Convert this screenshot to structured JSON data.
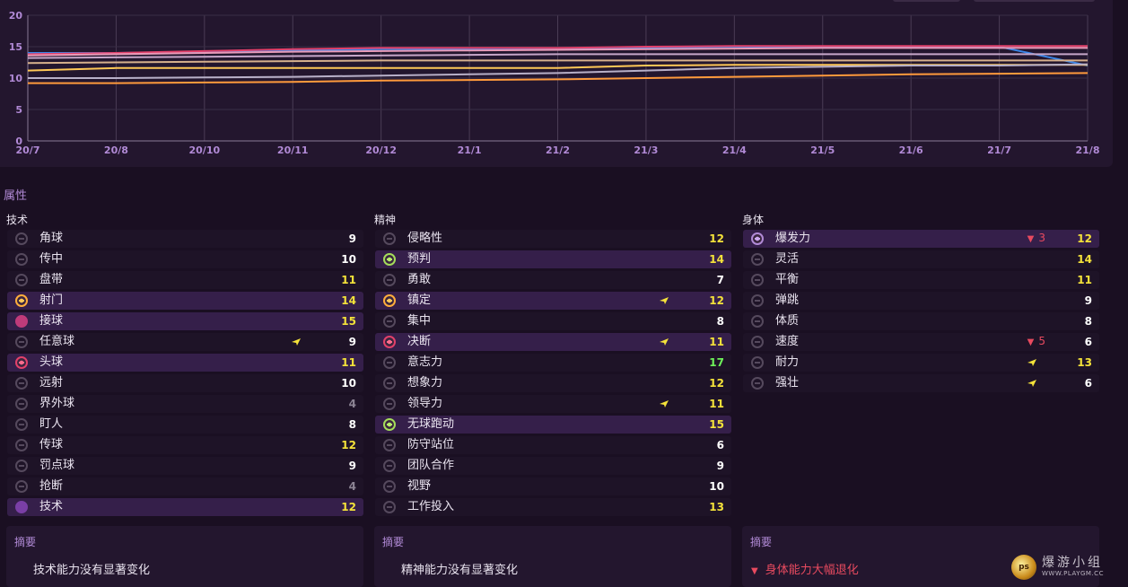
{
  "chart_data": {
    "type": "line",
    "categories": [
      "20/7",
      "20/8",
      "20/10",
      "20/11",
      "20/12",
      "21/1",
      "21/2",
      "21/3",
      "21/4",
      "21/5",
      "21/6",
      "21/7",
      "21/8"
    ],
    "ylim": [
      0,
      20
    ],
    "yticks": [
      "0",
      "5",
      "10",
      "15",
      "20"
    ],
    "grid": true,
    "series": [
      {
        "color": "#3a86e8",
        "values": [
          14,
          14,
          14.2,
          14.4,
          14.6,
          14.6,
          14.6,
          14.8,
          15,
          15,
          15,
          15,
          12
        ]
      },
      {
        "color": "#e2406a",
        "values": [
          13.8,
          14,
          14.3,
          14.6,
          14.8,
          14.8,
          14.8,
          15,
          15.1,
          15.1,
          15.1,
          15.1,
          15.1
        ]
      },
      {
        "color": "#e89ab8",
        "values": [
          13.6,
          13.8,
          14,
          14.2,
          14.3,
          14.4,
          14.5,
          14.6,
          14.7,
          14.8,
          14.8,
          14.8,
          14.8
        ]
      },
      {
        "color": "#c7a7c9",
        "values": [
          13.2,
          13.3,
          13.4,
          13.5,
          13.6,
          13.7,
          13.8,
          13.8,
          13.8,
          13.8,
          13.8,
          13.8,
          13.8
        ]
      },
      {
        "color": "#d6b08c",
        "values": [
          12.4,
          12.5,
          12.6,
          12.7,
          12.8,
          12.8,
          12.8,
          12.8,
          12.8,
          12.8,
          12.8,
          12.8,
          12.8
        ]
      },
      {
        "color": "#ffc857",
        "values": [
          11.2,
          11.6,
          11.6,
          11.6,
          11.6,
          11.6,
          11.6,
          12,
          12.1,
          12.1,
          12.1,
          12.1,
          12.1
        ]
      },
      {
        "color": "#b8b0c8",
        "values": [
          10,
          10,
          10.1,
          10.2,
          10.4,
          10.6,
          10.8,
          11.2,
          11.6,
          11.8,
          12,
          12,
          12.2
        ]
      },
      {
        "color": "#ff9a3c",
        "values": [
          9.2,
          9.2,
          9.3,
          9.4,
          9.6,
          9.7,
          9.8,
          10,
          10.2,
          10.4,
          10.6,
          10.7,
          10.8
        ]
      }
    ]
  },
  "section_title": "属性",
  "columns": [
    {
      "title": "技术",
      "rows": [
        {
          "name": "角球",
          "value": "9",
          "vc": "w",
          "dot": "",
          "hl": false,
          "trend": false,
          "drop": ""
        },
        {
          "name": "传中",
          "value": "10",
          "vc": "w",
          "dot": "",
          "hl": false,
          "trend": false,
          "drop": ""
        },
        {
          "name": "盘带",
          "value": "11",
          "vc": "y",
          "dot": "",
          "hl": false,
          "trend": false,
          "drop": ""
        },
        {
          "name": "射门",
          "value": "14",
          "vc": "y",
          "dot": "c-y",
          "hl": true,
          "trend": false,
          "drop": ""
        },
        {
          "name": "接球",
          "value": "15",
          "vc": "y",
          "dot": "c-m",
          "hl": true,
          "trend": false,
          "drop": ""
        },
        {
          "name": "任意球",
          "value": "9",
          "vc": "w",
          "dot": "",
          "hl": false,
          "trend": true,
          "drop": ""
        },
        {
          "name": "头球",
          "value": "11",
          "vc": "y",
          "dot": "c-r",
          "hl": true,
          "trend": false,
          "drop": ""
        },
        {
          "name": "远射",
          "value": "10",
          "vc": "w",
          "dot": "",
          "hl": false,
          "trend": false,
          "drop": ""
        },
        {
          "name": "界外球",
          "value": "4",
          "vc": "dim",
          "dot": "",
          "hl": false,
          "trend": false,
          "drop": ""
        },
        {
          "name": "盯人",
          "value": "8",
          "vc": "w",
          "dot": "",
          "hl": false,
          "trend": false,
          "drop": ""
        },
        {
          "name": "传球",
          "value": "12",
          "vc": "y",
          "dot": "",
          "hl": false,
          "trend": false,
          "drop": ""
        },
        {
          "name": "罚点球",
          "value": "9",
          "vc": "w",
          "dot": "",
          "hl": false,
          "trend": false,
          "drop": ""
        },
        {
          "name": "抢断",
          "value": "4",
          "vc": "dim",
          "dot": "",
          "hl": false,
          "trend": false,
          "drop": ""
        },
        {
          "name": "技术",
          "value": "12",
          "vc": "y",
          "dot": "c-full",
          "hl": true,
          "trend": false,
          "drop": ""
        }
      ]
    },
    {
      "title": "精神",
      "rows": [
        {
          "name": "侵略性",
          "value": "12",
          "vc": "y",
          "dot": "",
          "hl": false,
          "trend": false,
          "drop": ""
        },
        {
          "name": "预判",
          "value": "14",
          "vc": "y",
          "dot": "c-g",
          "hl": true,
          "trend": false,
          "drop": ""
        },
        {
          "name": "勇敢",
          "value": "7",
          "vc": "w",
          "dot": "",
          "hl": false,
          "trend": false,
          "drop": ""
        },
        {
          "name": "镇定",
          "value": "12",
          "vc": "y",
          "dot": "c-y",
          "hl": true,
          "trend": true,
          "drop": ""
        },
        {
          "name": "集中",
          "value": "8",
          "vc": "w",
          "dot": "",
          "hl": false,
          "trend": false,
          "drop": ""
        },
        {
          "name": "决断",
          "value": "11",
          "vc": "y",
          "dot": "c-r",
          "hl": true,
          "trend": true,
          "drop": ""
        },
        {
          "name": "意志力",
          "value": "17",
          "vc": "gr",
          "dot": "",
          "hl": false,
          "trend": false,
          "drop": ""
        },
        {
          "name": "想象力",
          "value": "12",
          "vc": "y",
          "dot": "",
          "hl": false,
          "trend": false,
          "drop": ""
        },
        {
          "name": "领导力",
          "value": "11",
          "vc": "y",
          "dot": "",
          "hl": false,
          "trend": true,
          "drop": ""
        },
        {
          "name": "无球跑动",
          "value": "15",
          "vc": "y",
          "dot": "c-g",
          "hl": true,
          "trend": false,
          "drop": ""
        },
        {
          "name": "防守站位",
          "value": "6",
          "vc": "w",
          "dot": "",
          "hl": false,
          "trend": false,
          "drop": ""
        },
        {
          "name": "团队合作",
          "value": "9",
          "vc": "w",
          "dot": "",
          "hl": false,
          "trend": false,
          "drop": ""
        },
        {
          "name": "视野",
          "value": "10",
          "vc": "w",
          "dot": "",
          "hl": false,
          "trend": false,
          "drop": ""
        },
        {
          "name": "工作投入",
          "value": "13",
          "vc": "y",
          "dot": "",
          "hl": false,
          "trend": false,
          "drop": ""
        }
      ]
    },
    {
      "title": "身体",
      "rows": [
        {
          "name": "爆发力",
          "value": "12",
          "vc": "y",
          "dot": "c-p",
          "hl": true,
          "trend": false,
          "drop": "3"
        },
        {
          "name": "灵活",
          "value": "14",
          "vc": "y",
          "dot": "",
          "hl": false,
          "trend": false,
          "drop": ""
        },
        {
          "name": "平衡",
          "value": "11",
          "vc": "y",
          "dot": "",
          "hl": false,
          "trend": false,
          "drop": ""
        },
        {
          "name": "弹跳",
          "value": "9",
          "vc": "w",
          "dot": "",
          "hl": false,
          "trend": false,
          "drop": ""
        },
        {
          "name": "体质",
          "value": "8",
          "vc": "w",
          "dot": "",
          "hl": false,
          "trend": false,
          "drop": ""
        },
        {
          "name": "速度",
          "value": "6",
          "vc": "w",
          "dot": "",
          "hl": false,
          "trend": false,
          "drop": "5"
        },
        {
          "name": "耐力",
          "value": "13",
          "vc": "y",
          "dot": "",
          "hl": false,
          "trend": true,
          "drop": ""
        },
        {
          "name": "强壮",
          "value": "6",
          "vc": "w",
          "dot": "",
          "hl": false,
          "trend": true,
          "drop": ""
        }
      ]
    }
  ],
  "summaries": [
    {
      "title": "摘要",
      "text": "技术能力没有显著变化",
      "negative": false
    },
    {
      "title": "摘要",
      "text": "精神能力没有显著变化",
      "negative": false
    },
    {
      "title": "摘要",
      "text": "身体能力大幅退化",
      "negative": true
    }
  ],
  "icons": {
    "trend": "trend-up-arrow-icon",
    "drop": "drop-down-arrow-icon"
  },
  "watermark": {
    "logo": "ps",
    "name": "爆游小组",
    "url": "WWW.PLAYGM.CC"
  }
}
